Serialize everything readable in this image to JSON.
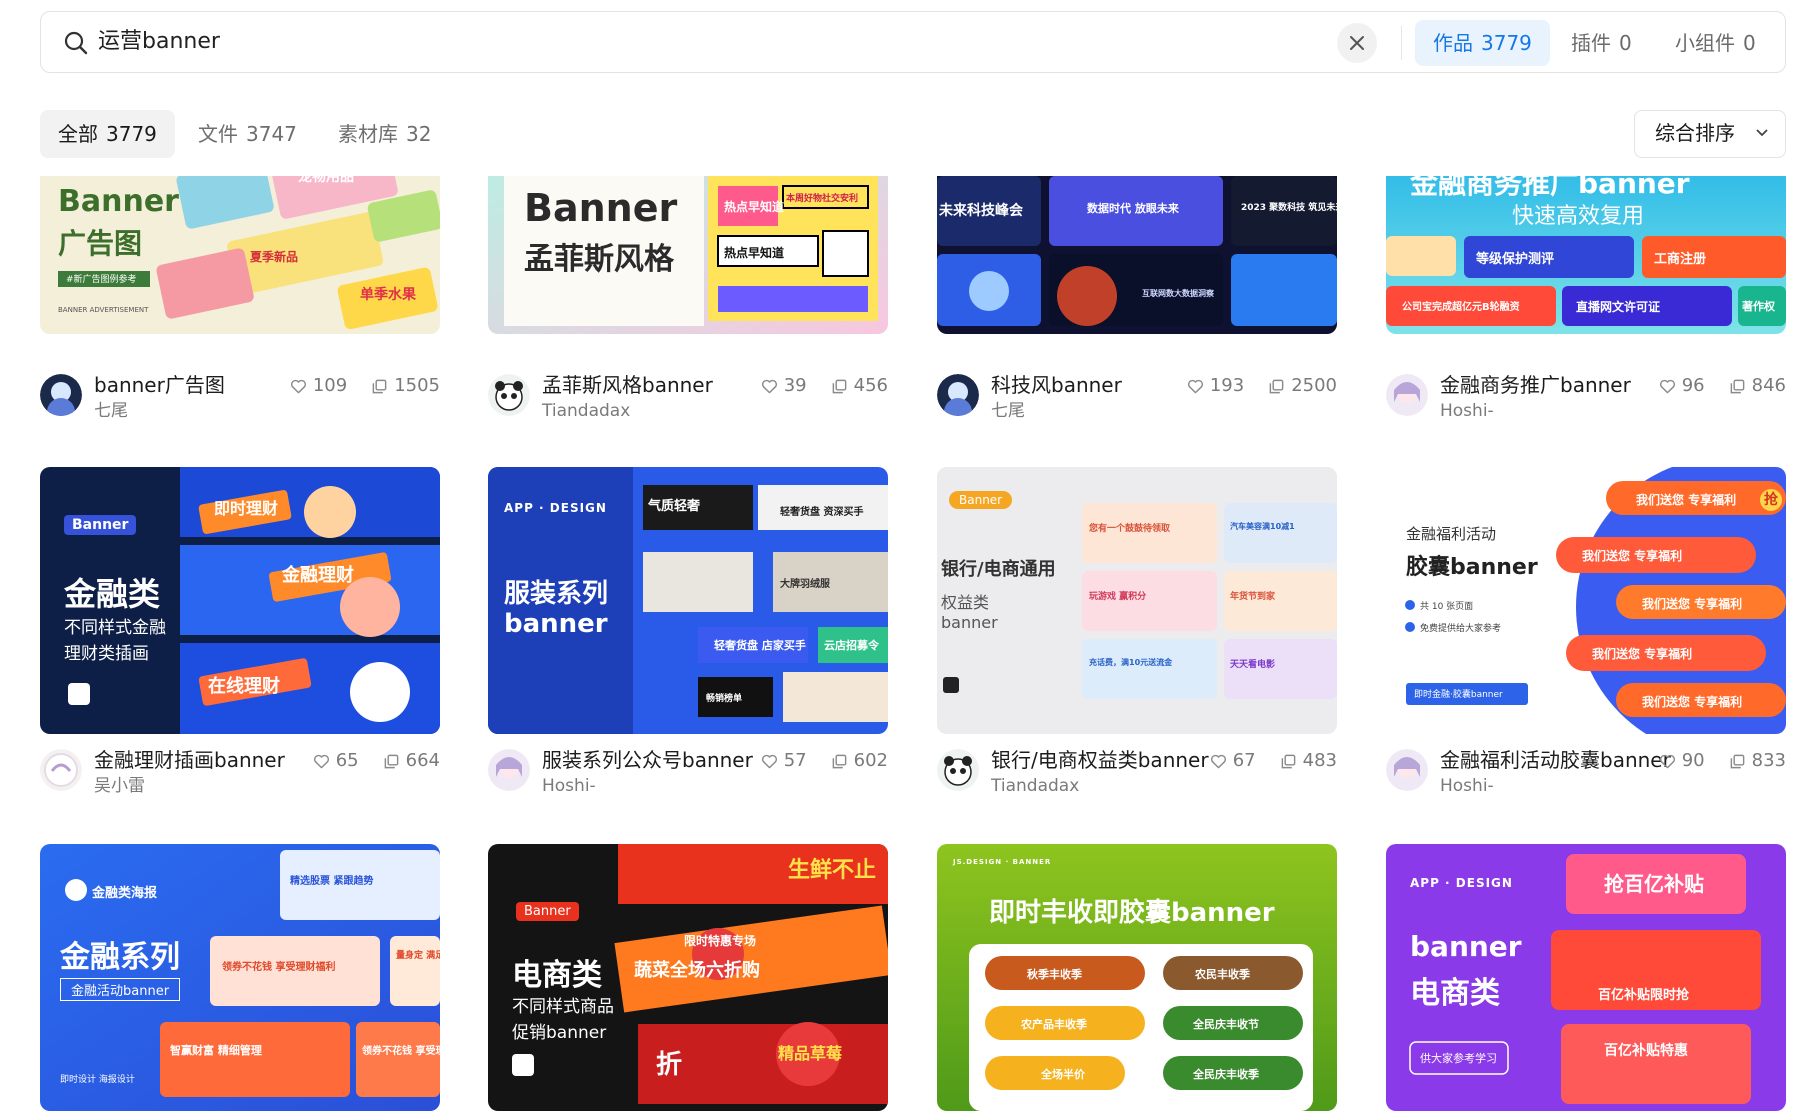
{
  "search": {
    "query": "运营banner",
    "tabs": [
      {
        "label": "作品",
        "count": "3779"
      },
      {
        "label": "插件",
        "count": "0"
      },
      {
        "label": "小组件",
        "count": "0"
      }
    ]
  },
  "filters": {
    "tabs": [
      {
        "label": "全部",
        "count": "3779"
      },
      {
        "label": "文件",
        "count": "3747"
      },
      {
        "label": "素材库",
        "count": "32"
      }
    ],
    "sort_label": "综合排序"
  },
  "cards": [
    {
      "title": "banner广告图",
      "author": "七尾",
      "likes": "109",
      "views": "1505",
      "thumb": {
        "line1": "Banner",
        "line2": "广告图",
        "tag1": "宠物用品",
        "tag2": "单季水果",
        "tag3": "夏季新品",
        "foot": "BANNER ADVERTISEMENT",
        "label": "#新广告图例参考"
      }
    },
    {
      "title": "孟菲斯风格banner",
      "author": "Tiandadax",
      "likes": "39",
      "views": "456",
      "thumb": {
        "line1": "Banner",
        "line2": "孟菲斯风格",
        "tag1": "热点早知道",
        "tag2": "本周好物社交安利",
        "tag3": "热点早知道"
      }
    },
    {
      "title": "科技风banner",
      "author": "七尾",
      "likes": "193",
      "views": "2500",
      "thumb": {
        "tag1": "未来科技峰会",
        "tag2": "数据时代 放眼未来",
        "tag3": "2023 聚数科技 筑见未来",
        "tag4": "互联网数大数据洞察"
      }
    },
    {
      "title": "金融商务推广banner",
      "author": "Hoshi-",
      "likes": "96",
      "views": "846",
      "thumb": {
        "line1": "金融商务推广banner",
        "line2": "快速高效复用",
        "tag1": "等级保护测评",
        "tag2": "工商注册",
        "tag3": "公司宝完成超亿元B轮融资",
        "tag4": "直播网文许可证",
        "tag5": "著作权"
      }
    },
    {
      "title": "金融理财插画banner",
      "author": "吴小雷",
      "likes": "65",
      "views": "664",
      "thumb": {
        "badge": "Banner",
        "line1": "金融类",
        "line2": "不同样式金融",
        "line3": "理财类插画",
        "tag1": "即时理财",
        "tag2": "金融理财",
        "tag3": "在线理财"
      }
    },
    {
      "title": "服装系列公众号banner",
      "author": "Hoshi-",
      "likes": "57",
      "views": "602",
      "thumb": {
        "label": "APP · DESIGN",
        "line1": "服装系列",
        "line2": "banner",
        "tag1": "气质轻奢",
        "tag2": "轻奢货盘 资深买手",
        "tag3": "大牌羽绒服",
        "tag4": "云店招募令",
        "tag5": "轻奢货盘 店家买手",
        "tag6": "畅销榜单"
      }
    },
    {
      "title": "银行/电商权益类banner",
      "author": "Tiandadax",
      "likes": "67",
      "views": "483",
      "thumb": {
        "badge": "Banner",
        "line1": "银行/电商通用",
        "line2": "权益类",
        "line3": "banner",
        "tag1": "您有一个鼓鼓待领取",
        "tag2": "汽车美容满10减1",
        "tag3": "玩游戏 赢积分",
        "tag4": "年货节到家",
        "tag5": "充话费，满10元送流金",
        "tag6": "天天看电影"
      }
    },
    {
      "title": "金融福利活动胶囊banner",
      "author": "Hoshi-",
      "likes": "90",
      "views": "833",
      "thumb": {
        "line1": "金融福利活动",
        "line2": "胶囊banner",
        "bullet1": "共 10 张页面",
        "bullet2": "免费提供给大家参考",
        "button": "即时金融·胶囊banner",
        "pill": "我们送您 专享福利",
        "chip": "抢"
      }
    },
    {
      "title": "",
      "author": "",
      "likes": "",
      "views": "",
      "thumb": {
        "label": "金融类海报",
        "line1": "金融系列",
        "line2": "金融活动banner",
        "tag1": "精选股票 紧跟趋势",
        "tag2": "领券不花钱 享受理财福利",
        "tag3": "智赢财富 精细管理",
        "tag4": "领券不花钱 享受理财福利",
        "tag5": "量身定 满足需",
        "foot": "即时设计 海报设计"
      }
    },
    {
      "title": "",
      "author": "",
      "likes": "",
      "views": "",
      "thumb": {
        "badge": "Banner",
        "line1": "电商类",
        "line2": "不同样式商品",
        "line3": "促销banner",
        "tag1": "生鲜不止",
        "tag2": "限时特惠专场",
        "tag3": "蔬菜全场六折购",
        "tag4": "精品草莓",
        "tag5": "折"
      }
    },
    {
      "title": "",
      "author": "",
      "likes": "",
      "views": "",
      "thumb": {
        "label": "JS.DESIGN · BANNER",
        "line1": "即时丰收即胶囊banner",
        "tag1": "秋季丰收季",
        "tag2": "农民丰收季",
        "tag3": "农产品丰收季",
        "tag4": "全民庆丰收节",
        "tag5": "全场半价",
        "tag6": "全民庆丰收季"
      }
    },
    {
      "title": "",
      "author": "",
      "likes": "",
      "views": "",
      "thumb": {
        "label": "APP · DESIGN",
        "line1": "banner",
        "line2": "电商类",
        "button": "供大家参考学习",
        "tag1": "抢百亿补贴",
        "tag2": "百亿补贴限时抢",
        "tag3": "百亿补贴特惠"
      }
    }
  ]
}
